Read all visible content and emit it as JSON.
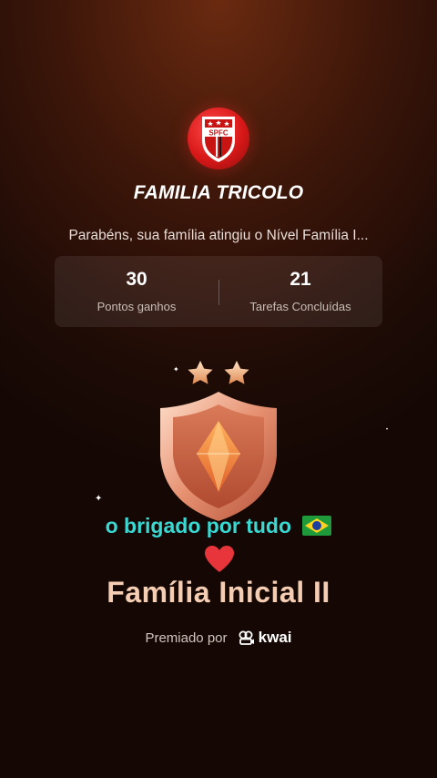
{
  "club": {
    "logo_text": "SPFC",
    "family_name": "FAMILIA TRICOLO"
  },
  "congrats_text": "Parabéns, sua família atingiu o Nível Família I...",
  "stats": {
    "points": {
      "value": "30",
      "label": "Pontos ganhos"
    },
    "tasks": {
      "value": "21",
      "label": "Tarefas Concluídas"
    }
  },
  "badge": {
    "stars": 2,
    "level_title": "Família Inicial II"
  },
  "user_caption": "o brigado por tudo",
  "awarded": {
    "prefix": "Premiado por",
    "brand": "kwai"
  },
  "icons": [
    "spfc-logo-icon",
    "star-icon",
    "shield-badge-icon",
    "brazil-flag-icon",
    "heart-icon",
    "kwai-logo-icon",
    "sparkle-icon"
  ],
  "colors": {
    "background": "#1e0b06",
    "caption": "#39d8d2",
    "level_title": "#f4cdb3",
    "logo_red": "#d81818"
  }
}
